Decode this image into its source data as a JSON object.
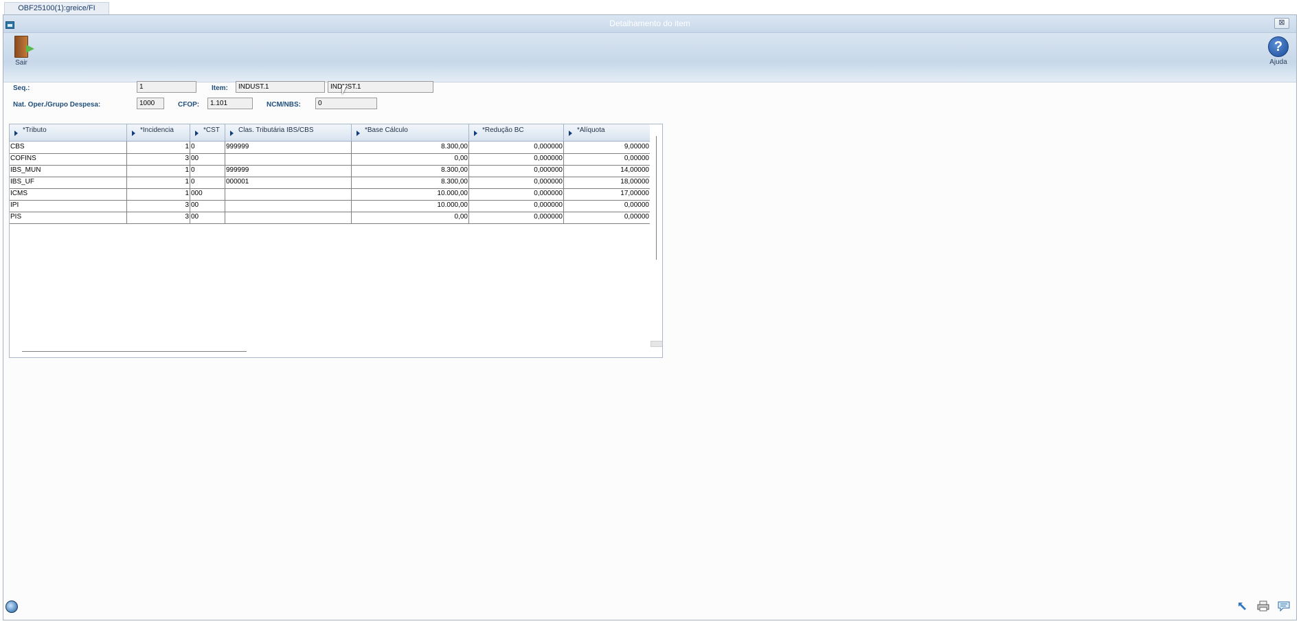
{
  "tab": {
    "label": "OBF25100(1):greice/FI"
  },
  "window": {
    "title": "Detalhamento do item",
    "close_symbol": "⊠"
  },
  "toolbar": {
    "exit_label": "Sair",
    "help_label": "Ajuda",
    "help_symbol": "?"
  },
  "form": {
    "seq_label": "Seq.:",
    "seq_value": "1",
    "item_label": "Item:",
    "item_code": "INDUST.1",
    "item_desc": "INDUST.1",
    "natop_label": "Nat. Oper./Grupo Despesa:",
    "natop_value": "1000",
    "cfop_label": "CFOP:",
    "cfop_value": "1.101",
    "ncm_label": "NCM/NBS:",
    "ncm_value": "0"
  },
  "grid": {
    "columns": [
      "*Tributo",
      "*Incidencia",
      "*CST",
      "Clas. Tributária IBS/CBS",
      "*Base Cálculo",
      "*Redução BC",
      "*Alíquota"
    ],
    "rows": [
      [
        "CBS",
        "1",
        "0",
        "999999",
        "8.300,00",
        "0,000000",
        "9,00000"
      ],
      [
        "COFINS",
        "3",
        "00",
        "",
        "0,00",
        "0,000000",
        "0,00000"
      ],
      [
        "IBS_MUN",
        "1",
        "0",
        "999999",
        "8.300,00",
        "0,000000",
        "14,00000"
      ],
      [
        "IBS_UF",
        "1",
        "0",
        "000001",
        "8.300,00",
        "0,000000",
        "18,00000"
      ],
      [
        "ICMS",
        "1",
        "000",
        "",
        "10.000,00",
        "0,000000",
        "17,00000"
      ],
      [
        "IPI",
        "3",
        "00",
        "",
        "10.000,00",
        "0,000000",
        "0,00000"
      ],
      [
        "PIS",
        "3",
        "00",
        "",
        "0,00",
        "0,000000",
        "0,00000"
      ]
    ]
  },
  "icons": [
    "door-exit-icon",
    "help-icon",
    "globe-icon",
    "expand-icon",
    "print-icon",
    "chat-icon"
  ]
}
